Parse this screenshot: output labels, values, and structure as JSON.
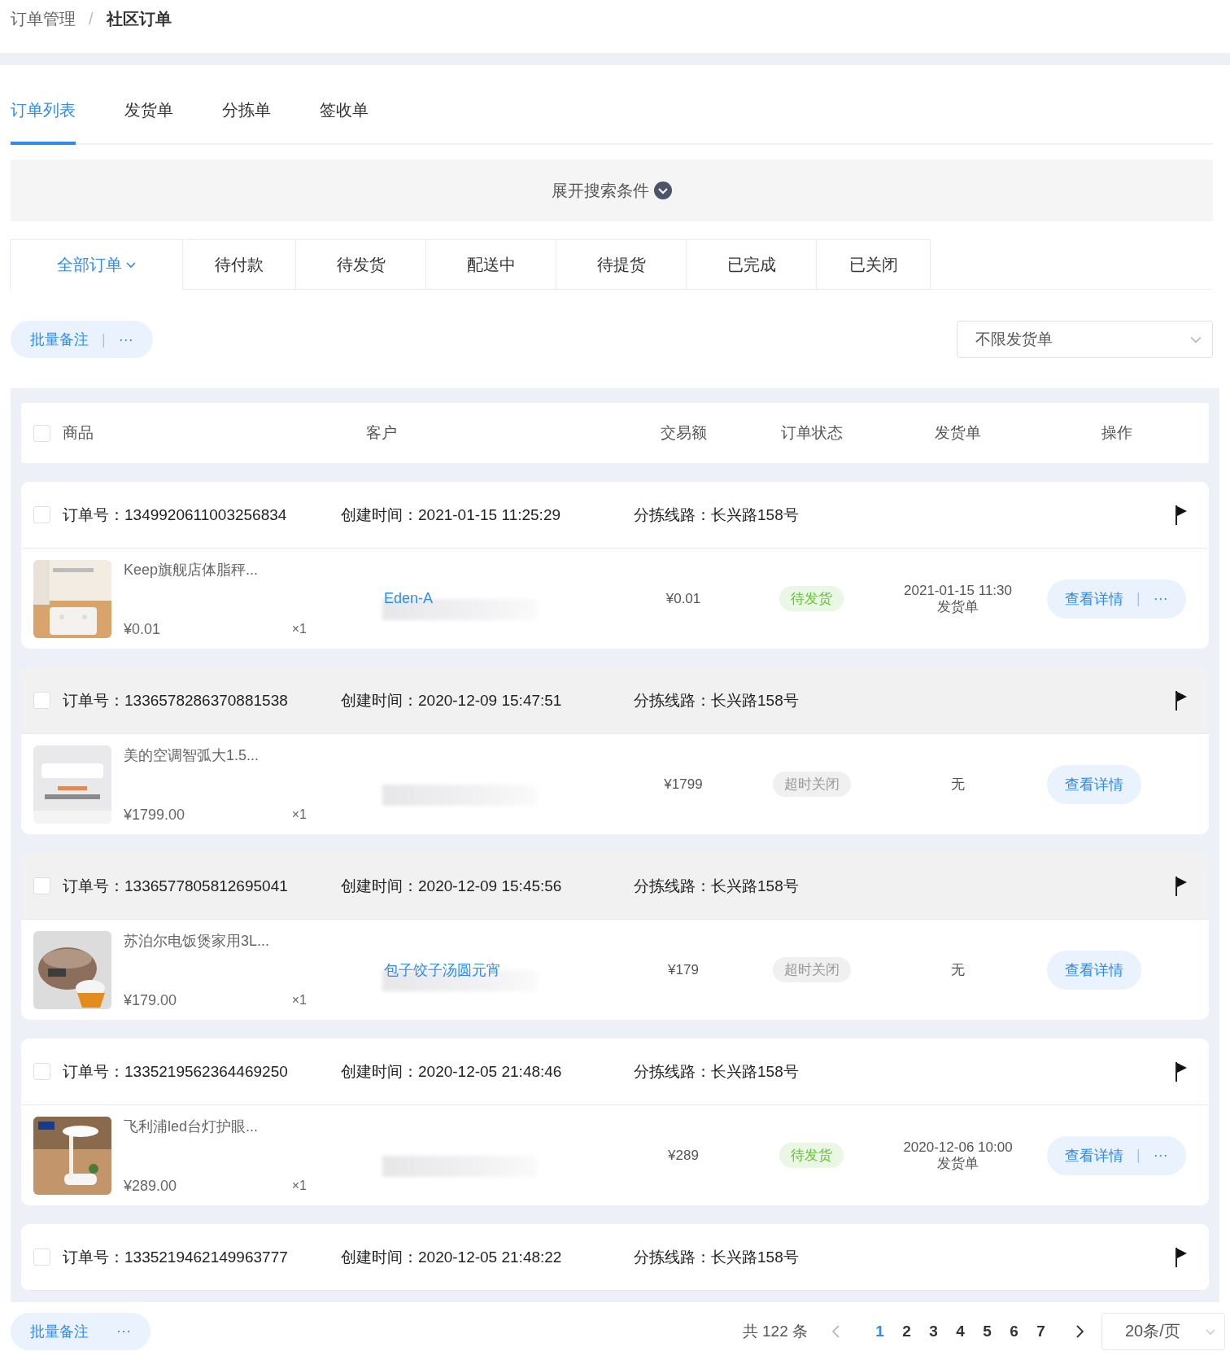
{
  "breadcrumb": [
    {
      "label": "订单管理",
      "current": false
    },
    {
      "label": "社区订单",
      "current": true
    }
  ],
  "tabs": [
    {
      "label": "订单列表",
      "selected": true
    },
    {
      "label": "发货单",
      "selected": false
    },
    {
      "label": "分拣单",
      "selected": false
    },
    {
      "label": "签收单",
      "selected": false
    }
  ],
  "search_toggle": {
    "label": "展开搜索条件"
  },
  "status_tabs": [
    {
      "label": "全部订单",
      "selected": true,
      "dropdown": true
    },
    {
      "label": "待付款",
      "selected": false,
      "dropdown": false
    },
    {
      "label": "待发货",
      "selected": false,
      "dropdown": false
    },
    {
      "label": "配送中",
      "selected": false,
      "dropdown": false
    },
    {
      "label": "待提货",
      "selected": false,
      "dropdown": false
    },
    {
      "label": "已完成",
      "selected": false,
      "dropdown": false
    },
    {
      "label": "已关闭",
      "selected": false,
      "dropdown": false
    }
  ],
  "breadcrumb_separator": "/",
  "batch_actions": {
    "label": "批量备注",
    "separator": "|",
    "more": "···"
  },
  "shipment_filter": {
    "value": "不限发货单"
  },
  "table": {
    "select_all": {
      "checked": false
    },
    "columns": [
      "商品",
      "客户",
      "交易额",
      "订单状态",
      "发货单",
      "操作"
    ],
    "orders": [
      {
        "checked": false,
        "shaded": false,
        "order_no": "订单号：1349920611003256834",
        "created": "创建时间：2021-01-15 11:25:29",
        "route": "分拣线路：长兴路158号",
        "item": {
          "name": "Keep旗舰店体脂秤...",
          "price": "¥0.01",
          "qty": "×1"
        },
        "customer": {
          "name": "Eden-A"
        },
        "amount": "¥0.01",
        "status": {
          "label": "待发货",
          "kind": "pending"
        },
        "shipment": {
          "time": "2021-01-15 11:30",
          "label": "发货单"
        },
        "actions": {
          "detail": "查看详情",
          "separator": "|",
          "more": "···"
        }
      },
      {
        "checked": false,
        "shaded": true,
        "order_no": "订单号：1336578286370881538",
        "created": "创建时间：2020-12-09 15:47:51",
        "route": "分拣线路：长兴路158号",
        "item": {
          "name": "美的空调智弧大1.5...",
          "price": "¥1799.00",
          "qty": "×1"
        },
        "amount": "¥1799",
        "status": {
          "label": "超时关闭",
          "kind": "closed"
        },
        "shipment": {
          "none": "无"
        },
        "actions": {
          "detail": "查看详情"
        }
      },
      {
        "checked": false,
        "shaded": true,
        "order_no": "订单号：1336577805812695041",
        "created": "创建时间：2020-12-09 15:45:56",
        "route": "分拣线路：长兴路158号",
        "item": {
          "name": "苏泊尔电饭煲家用3L...",
          "price": "¥179.00",
          "qty": "×1"
        },
        "customer": {
          "name": "包子饺子汤圆元宵"
        },
        "amount": "¥179",
        "status": {
          "label": "超时关闭",
          "kind": "closed"
        },
        "shipment": {
          "none": "无"
        },
        "actions": {
          "detail": "查看详情"
        }
      },
      {
        "checked": false,
        "shaded": false,
        "order_no": "订单号：1335219562364469250",
        "created": "创建时间：2020-12-05 21:48:46",
        "route": "分拣线路：长兴路158号",
        "item": {
          "name": "飞利浦led台灯护眼...",
          "price": "¥289.00",
          "qty": "×1"
        },
        "amount": "¥289",
        "status": {
          "label": "待发货",
          "kind": "pending"
        },
        "shipment": {
          "time": "2020-12-06 10:00",
          "label": "发货单"
        },
        "actions": {
          "detail": "查看详情",
          "separator": "|",
          "more": "···"
        }
      },
      {
        "checked": false,
        "shaded": false,
        "order_no": "订单号：1335219462149963777",
        "created": "创建时间：2020-12-05 21:48:22",
        "route": "分拣线路：长兴路158号"
      }
    ]
  },
  "footer": {
    "batch_label": "批量备注",
    "batch_more": "···"
  },
  "pagination": {
    "total": "共 122 条",
    "pages": [
      {
        "label": "1",
        "selected": true
      },
      {
        "label": "2",
        "selected": false
      },
      {
        "label": "3",
        "selected": false
      },
      {
        "label": "4",
        "selected": false
      },
      {
        "label": "5",
        "selected": false
      },
      {
        "label": "6",
        "selected": false
      },
      {
        "label": "7",
        "selected": false
      }
    ],
    "page_size": "20条/页"
  }
}
